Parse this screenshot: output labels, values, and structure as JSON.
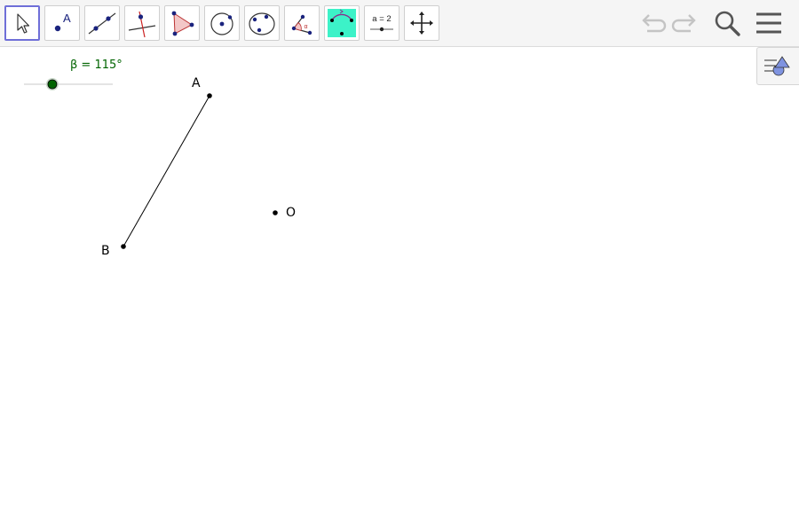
{
  "toolbar": {
    "tools": [
      {
        "name": "move-tool",
        "selected": true
      },
      {
        "name": "point-tool"
      },
      {
        "name": "line-tool"
      },
      {
        "name": "perpendicular-line-tool"
      },
      {
        "name": "polygon-tool"
      },
      {
        "name": "circle-with-center-tool"
      },
      {
        "name": "circle-through-three-points-tool"
      },
      {
        "name": "angle-tool"
      },
      {
        "name": "reflect-about-line-tool"
      },
      {
        "name": "slider-tool",
        "label": "a = 2"
      },
      {
        "name": "move-graphics-view-tool"
      }
    ],
    "right": [
      "undo-icon",
      "redo-icon",
      "search-icon",
      "menu-icon"
    ]
  },
  "slider": {
    "caption": "β = 115°",
    "value_degrees": 115,
    "min_degrees": 0,
    "max_degrees": 360
  },
  "points": {
    "A": "A",
    "B": "B",
    "O": "O"
  },
  "colors": {
    "accent": "#6f6fd8",
    "slider_green": "#006400",
    "point_dark": "#000000",
    "tool_point_blue": "#1a237e",
    "reflect_tool_bg": "#3cf2c8"
  }
}
